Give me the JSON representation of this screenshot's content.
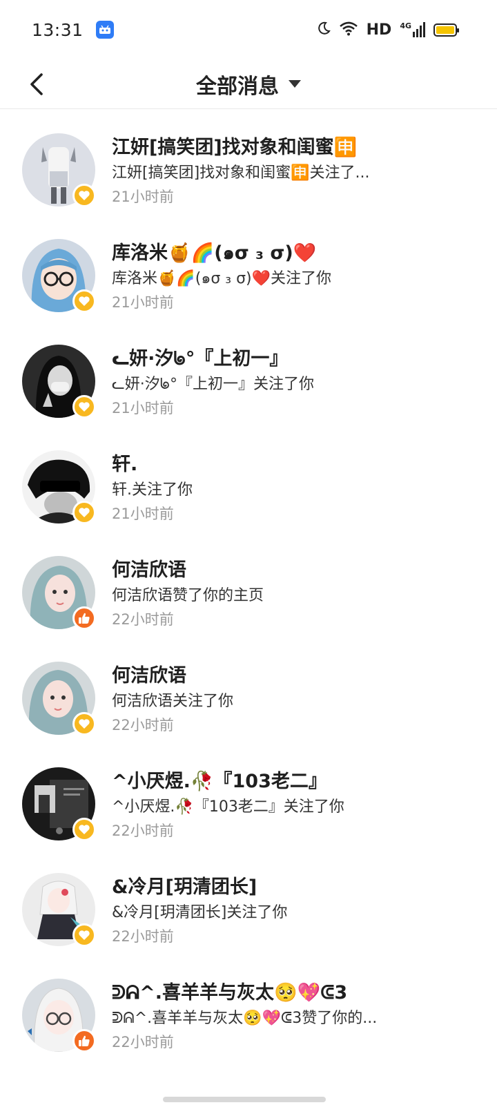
{
  "status_bar": {
    "time": "13:31",
    "network_label": "HD",
    "cell_label": "4G",
    "battery_color": "#f5c400",
    "icons": [
      "app-notification-icon",
      "moon-icon",
      "wifi-icon",
      "signal-icon",
      "battery-icon"
    ]
  },
  "header": {
    "title": "全部消息",
    "back_icon": "chevron-left-icon",
    "dropdown_icon": "caret-down-icon"
  },
  "colors": {
    "follow_badge": "#f8b820",
    "like_badge": "#f36b21",
    "time_text": "#9a9a9a"
  },
  "notifications": [
    {
      "name": "江妍[搞笑团]找对象和闺蜜🈸",
      "desc": "江妍[搞笑团]找对象和闺蜜🈸关注了...",
      "time": "21小时前",
      "type": "follow"
    },
    {
      "name": "库洛米🍯🌈(๑σ ₃ σ)❤️",
      "desc": "库洛米🍯🌈(๑σ ₃ σ)❤️关注了你",
      "time": "21小时前",
      "type": "follow"
    },
    {
      "name": "ᓚ妍·汐ᖚ°『上初一』",
      "desc": "ᓚ妍·汐ᖚ°『上初一』关注了你",
      "time": "21小时前",
      "type": "follow"
    },
    {
      "name": "轩.",
      "desc": "轩.关注了你",
      "time": "21小时前",
      "type": "follow"
    },
    {
      "name": "何洁欣语",
      "desc": "何洁欣语赞了你的主页",
      "time": "22小时前",
      "type": "like"
    },
    {
      "name": "何洁欣语",
      "desc": "何洁欣语关注了你",
      "time": "22小时前",
      "type": "follow"
    },
    {
      "name": "^小厌煜.🥀『103老二』",
      "desc": "^小厌煜.🥀『103老二』关注了你",
      "time": "22小时前",
      "type": "follow"
    },
    {
      "name": "&冷月[玥清团长]",
      "desc": "&冷月[玥清团长]关注了你",
      "time": "22小时前",
      "type": "follow"
    },
    {
      "name": "ᕲᕱ^.喜羊羊与灰太🥺💖ᕳ3",
      "desc": "ᕲᕱ^.喜羊羊与灰太🥺💖ᕳ3赞了你的...",
      "time": "22小时前",
      "type": "like"
    }
  ]
}
